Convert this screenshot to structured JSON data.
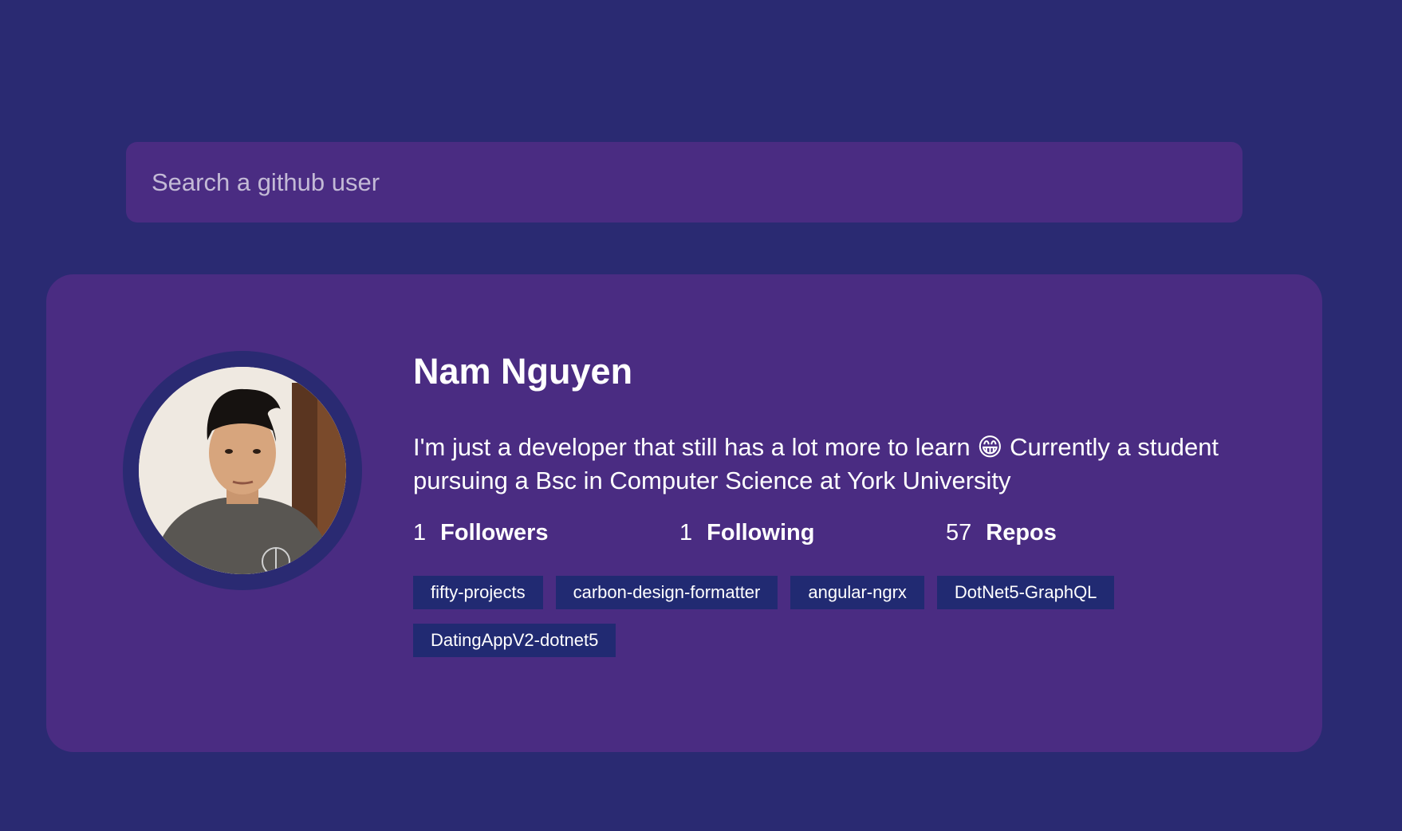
{
  "search": {
    "placeholder": "Search a github user",
    "value": ""
  },
  "user": {
    "name": "Nam Nguyen",
    "bio": "I'm just a developer that still has a lot more to learn 😁 Currently a student pursuing a Bsc in Computer Science at York University",
    "stats": [
      {
        "count": "1",
        "label": "Followers"
      },
      {
        "count": "1",
        "label": "Following"
      },
      {
        "count": "57",
        "label": "Repos"
      }
    ],
    "repos": [
      "fifty-projects",
      "carbon-design-formatter",
      "angular-ngrx",
      "DotNet5-GraphQL",
      "DatingAppV2-dotnet5"
    ]
  },
  "colors": {
    "background": "#2a2a72",
    "card": "#4a2c82",
    "repo_badge": "#212a72",
    "text": "#ffffff"
  }
}
